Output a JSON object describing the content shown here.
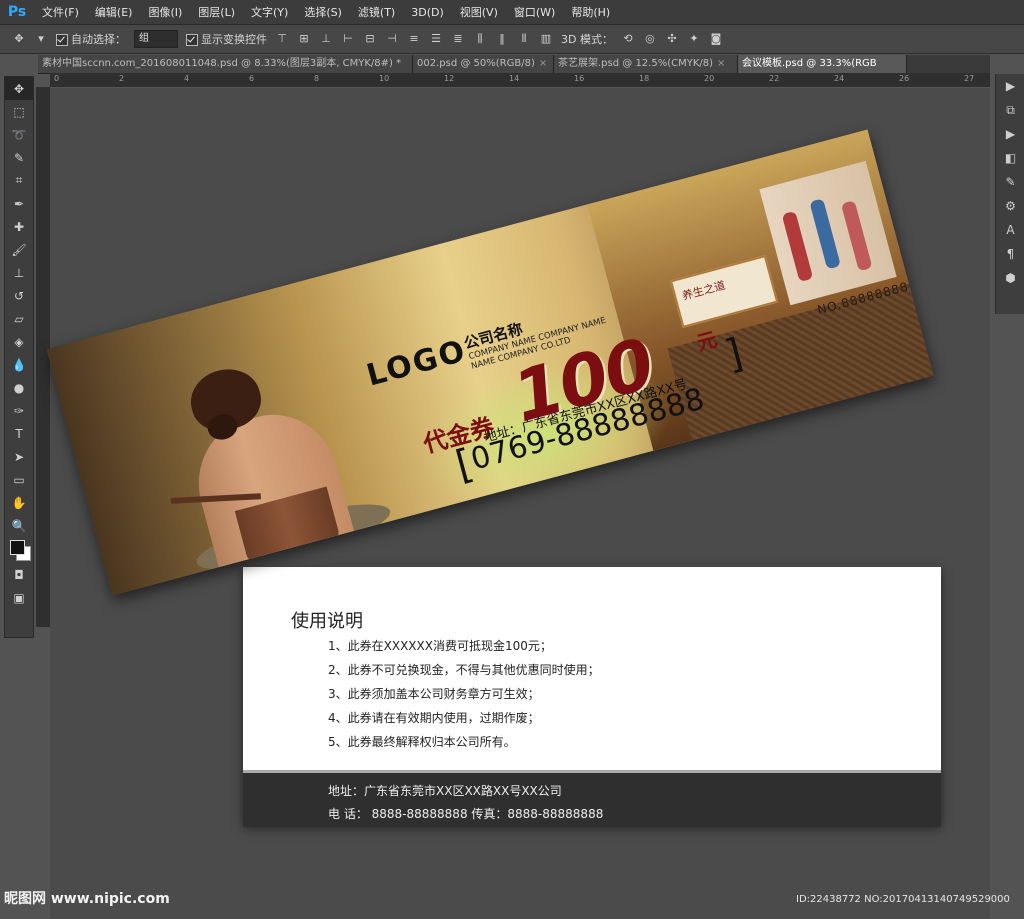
{
  "app": {
    "name": "Ps",
    "accent": "#31a8ff"
  },
  "menu": [
    "文件(F)",
    "编辑(E)",
    "图像(I)",
    "图层(L)",
    "文字(Y)",
    "选择(S)",
    "滤镜(T)",
    "3D(D)",
    "视图(V)",
    "窗口(W)",
    "帮助(H)"
  ],
  "options": {
    "auto_select_label": "自动选择：",
    "auto_select_value": "组",
    "show_transform_label": "显示变换控件",
    "mode_3d_label": "3D 模式："
  },
  "tabs": [
    {
      "label": "素材中国sccnn.com_201608011048.psd @ 8.33%(图层3副本, CMYK/8#) *",
      "active": false
    },
    {
      "label": "002.psd @ 50%(RGB/8)",
      "active": false
    },
    {
      "label": "茶艺展架.psd @ 12.5%(CMYK/8)",
      "active": false
    },
    {
      "label": "会议模板.psd @ 33.3%(RGB",
      "active": true
    }
  ],
  "ruler_ticks": [
    "0",
    "2",
    "4",
    "6",
    "8",
    "10",
    "12",
    "14",
    "16",
    "18",
    "20",
    "22",
    "24",
    "26",
    "27"
  ],
  "card_front": {
    "logo": "LOGO",
    "company_cn": "公司名称",
    "company_en_line1": "COMPANY NAME COMPANY NAME",
    "company_en_line2": "NAME COMPANY CO.LTD",
    "amount": "100",
    "currency": "元",
    "voucher_label": "代金券",
    "address": "地址：广东省东莞市XX区XX路XX号",
    "phone": "0769-88888888",
    "serial": "NO.88888888",
    "panel_text": "养生之道"
  },
  "card_back": {
    "title": "使用说明",
    "rules": [
      "1、此券在XXXXXX消费可抵现金100元；",
      "2、此券不可兑换现金，不得与其他优惠同时使用；",
      "3、此券须加盖本公司财务章方可生效；",
      "4、此券请在有效期内使用，过期作废；",
      "5、此券最终解释权归本公司所有。"
    ],
    "footer_address": "地址：广东省东莞市XX区XX路XX号XX公司",
    "footer_phone": "电 话： 8888-88888888  传真：8888-88888888"
  },
  "watermark": "昵图网 www.nipic.com",
  "id_stamp": "ID:22438772 NO:20170413140749529000"
}
